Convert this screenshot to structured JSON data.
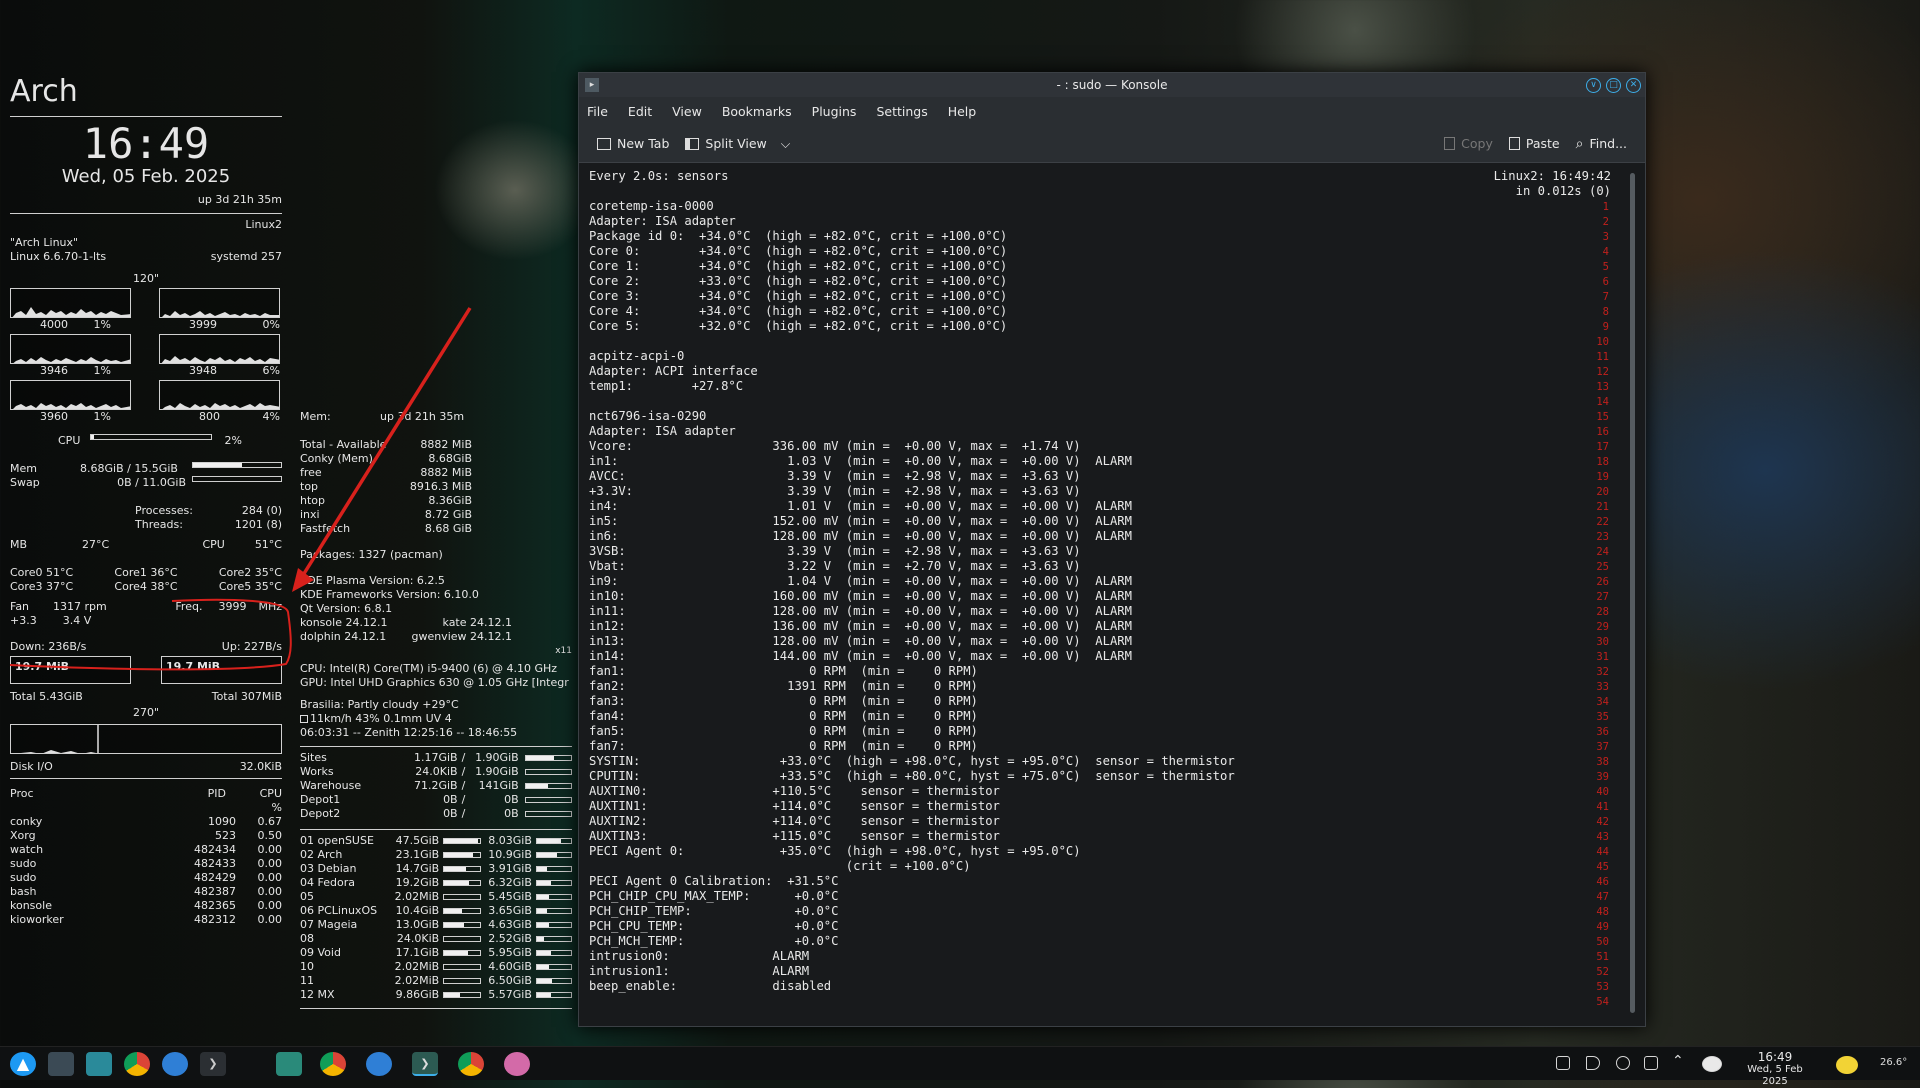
{
  "conky": {
    "distro": "Arch",
    "time": "16:49",
    "date": "Wed, 05 Feb. 2025",
    "uptime": "up 3d 21h 35m",
    "hostname": "Linux2",
    "os": "\"Arch Linux\"",
    "kernel": "Linux 6.6.70-1-lts",
    "init": "systemd 257",
    "interval": "120\"",
    "cpu_cores": [
      {
        "freq": "4000",
        "pct": "1%"
      },
      {
        "freq": "3999",
        "pct": "0%"
      },
      {
        "freq": "3946",
        "pct": "1%"
      },
      {
        "freq": "3948",
        "pct": "6%"
      },
      {
        "freq": "3960",
        "pct": "1%"
      },
      {
        "freq": "800",
        "pct": "4%"
      }
    ],
    "cpu_label": "CPU",
    "cpu_total": "2%",
    "cpu_fill": 0.02,
    "mem_label": "Mem",
    "mem_val": "8.68GiB / 15.5GiB",
    "mem_fill": 0.56,
    "swap_label": "Swap",
    "swap_val": "0B / 11.0GiB",
    "swap_fill": 0.0,
    "proc_label": "Processes:",
    "proc_val": "284 (0)",
    "threads_label": "Threads:",
    "threads_val": "1201 (8)",
    "mb_label": "MB",
    "mb_temp": "27°C",
    "cpu_temp_label": "CPU",
    "cpu_temp": "51°C",
    "cores": [
      "Core0 51°C",
      "Core1 36°C",
      "Core2 35°C",
      "Core3 37°C",
      "Core4 38°C",
      "Core5 35°C"
    ],
    "fan_label": "Fan",
    "fan_val": "1317 rpm",
    "freq_label": "Freq.",
    "freq_val": "3999",
    "freq_unit": "MHz",
    "v33": "+3.3",
    "v34": "3.4 V",
    "down": "Down: 236B/s",
    "up": "Up: 227B/s",
    "down_box": "19.7 MiB",
    "up_box": "19.7 MiB",
    "total_down": "Total 5.43GiB",
    "total_up": "Total 307MiB",
    "interval2": "270\"",
    "diskio_label": "Disk I/O",
    "diskio_val": "32.0KiB",
    "proc_hdr": [
      "Proc",
      "PID",
      "CPU",
      "%"
    ],
    "procs": [
      {
        "n": "conky",
        "p": "1090",
        "c": "0.67"
      },
      {
        "n": "Xorg",
        "p": "523",
        "c": "0.50"
      },
      {
        "n": "watch",
        "p": "482434",
        "c": "0.00"
      },
      {
        "n": "sudo",
        "p": "482433",
        "c": "0.00"
      },
      {
        "n": "sudo",
        "p": "482429",
        "c": "0.00"
      },
      {
        "n": "bash",
        "p": "482387",
        "c": "0.00"
      },
      {
        "n": "konsole",
        "p": "482365",
        "c": "0.00"
      },
      {
        "n": "kioworker",
        "p": "482312",
        "c": "0.00"
      }
    ]
  },
  "conky2": {
    "mem_label": "Mem:",
    "uptime": "up 3d 21h 35m",
    "memrows": [
      {
        "n": "Total - Available",
        "v": "8882 MiB"
      },
      {
        "n": "Conky (Mem)",
        "v": "8.68GiB"
      },
      {
        "n": "free",
        "v": "8882  MiB"
      },
      {
        "n": "top",
        "v": "8916.3  MiB"
      },
      {
        "n": "htop",
        "v": "8.36GiB"
      },
      {
        "n": "inxi",
        "v": "8.72 GiB"
      },
      {
        "n": "Fastfetch",
        "v": "8.68 GiB"
      }
    ],
    "packages": "Packages: 1327 (pacman)",
    "kde": [
      "KDE Plasma Version: 6.2.5",
      "KDE Frameworks Version: 6.10.0",
      "Qt Version: 6.8.1"
    ],
    "konsole": "konsole 24.12.1",
    "kate": "kate 24.12.1",
    "dolphin": "dolphin 24.12.1",
    "gwenview": "gwenview 24.12.1",
    "x11": "x11",
    "cpu": "CPU: Intel(R) Core(TM) i5-9400 (6) @ 4.10 GHz",
    "gpu": "GPU: Intel UHD Graphics 630 @ 1.05 GHz [Integr",
    "weather1": "Brasilia:   Partly cloudy   +29°C",
    "weather2": "11km/h   43%   0.1mm   UV 4",
    "weather3": "06:03:31 -- Zenith 12:25:16 -- 18:46:55",
    "drives": [
      {
        "n": "Sites",
        "u": "1.17GiB",
        "t": "1.90GiB",
        "f": 0.62
      },
      {
        "n": "Works",
        "u": "24.0KiB",
        "t": "1.90GiB",
        "f": 0.0
      },
      {
        "n": "Warehouse",
        "u": "71.2GiB",
        "t": "141GiB",
        "f": 0.5
      },
      {
        "n": "Depot1",
        "u": "0B",
        "t": "0B",
        "f": 0.0
      },
      {
        "n": "Depot2",
        "u": "0B",
        "t": "0B",
        "f": 0.0
      }
    ],
    "parts": [
      {
        "n": "01 openSUSE",
        "a": "47.5GiB",
        "af": 0.95,
        "b": "8.03GiB",
        "bf": 0.7
      },
      {
        "n": "02 Arch",
        "a": "23.1GiB",
        "af": 0.8,
        "b": "10.9GiB",
        "bf": 0.6
      },
      {
        "n": "03 Debian",
        "a": "14.7GiB",
        "af": 0.6,
        "b": "3.91GiB",
        "bf": 0.3
      },
      {
        "n": "04 Fedora",
        "a": "19.2GiB",
        "af": 0.7,
        "b": "6.32GiB",
        "bf": 0.4
      },
      {
        "n": "05",
        "a": "2.02MiB",
        "af": 0.0,
        "b": "5.45GiB",
        "bf": 0.35
      },
      {
        "n": "06 PCLinuxOS",
        "a": "10.4GiB",
        "af": 0.5,
        "b": "3.65GiB",
        "bf": 0.3
      },
      {
        "n": "07 Mageia",
        "a": "13.0GiB",
        "af": 0.55,
        "b": "4.63GiB",
        "bf": 0.35
      },
      {
        "n": "08",
        "a": "24.0KiB",
        "af": 0.0,
        "b": "2.52GiB",
        "bf": 0.2
      },
      {
        "n": "09 Void",
        "a": "17.1GiB",
        "af": 0.65,
        "b": "5.95GiB",
        "bf": 0.4
      },
      {
        "n": "10",
        "a": "2.02MiB",
        "af": 0.0,
        "b": "4.60GiB",
        "bf": 0.35
      },
      {
        "n": "11",
        "a": "2.02MiB",
        "af": 0.0,
        "b": "6.50GiB",
        "bf": 0.45
      },
      {
        "n": "12 MX",
        "a": "9.86GiB",
        "af": 0.45,
        "b": "5.57GiB",
        "bf": 0.4
      }
    ]
  },
  "konsole": {
    "title": "- : sudo — Konsole",
    "menu": [
      "File",
      "Edit",
      "View",
      "Bookmarks",
      "Plugins",
      "Settings",
      "Help"
    ],
    "new_tab": "New Tab",
    "split_view": "Split View",
    "copy": "Copy",
    "paste": "Paste",
    "find": "Find...",
    "term_right1": "Linux2: 16:49:42",
    "term_right2": "in 0.012s (0)",
    "output": "Every 2.0s: sensors\n\ncoretemp-isa-0000\nAdapter: ISA adapter\nPackage id 0:  +34.0°C  (high = +82.0°C, crit = +100.0°C)\nCore 0:        +34.0°C  (high = +82.0°C, crit = +100.0°C)\nCore 1:        +34.0°C  (high = +82.0°C, crit = +100.0°C)\nCore 2:        +33.0°C  (high = +82.0°C, crit = +100.0°C)\nCore 3:        +34.0°C  (high = +82.0°C, crit = +100.0°C)\nCore 4:        +34.0°C  (high = +82.0°C, crit = +100.0°C)\nCore 5:        +32.0°C  (high = +82.0°C, crit = +100.0°C)\n\nacpitz-acpi-0\nAdapter: ACPI interface\ntemp1:        +27.8°C\n\nnct6796-isa-0290\nAdapter: ISA adapter\nVcore:                   336.00 mV (min =  +0.00 V, max =  +1.74 V)\nin1:                       1.03 V  (min =  +0.00 V, max =  +0.00 V)  ALARM\nAVCC:                      3.39 V  (min =  +2.98 V, max =  +3.63 V)\n+3.3V:                     3.39 V  (min =  +2.98 V, max =  +3.63 V)\nin4:                       1.01 V  (min =  +0.00 V, max =  +0.00 V)  ALARM\nin5:                     152.00 mV (min =  +0.00 V, max =  +0.00 V)  ALARM\nin6:                     128.00 mV (min =  +0.00 V, max =  +0.00 V)  ALARM\n3VSB:                      3.39 V  (min =  +2.98 V, max =  +3.63 V)\nVbat:                      3.22 V  (min =  +2.70 V, max =  +3.63 V)\nin9:                       1.04 V  (min =  +0.00 V, max =  +0.00 V)  ALARM\nin10:                    160.00 mV (min =  +0.00 V, max =  +0.00 V)  ALARM\nin11:                    128.00 mV (min =  +0.00 V, max =  +0.00 V)  ALARM\nin12:                    136.00 mV (min =  +0.00 V, max =  +0.00 V)  ALARM\nin13:                    128.00 mV (min =  +0.00 V, max =  +0.00 V)  ALARM\nin14:                    144.00 mV (min =  +0.00 V, max =  +0.00 V)  ALARM\nfan1:                         0 RPM  (min =    0 RPM)\nfan2:                      1391 RPM  (min =    0 RPM)\nfan3:                         0 RPM  (min =    0 RPM)\nfan4:                         0 RPM  (min =    0 RPM)\nfan5:                         0 RPM  (min =    0 RPM)\nfan7:                         0 RPM  (min =    0 RPM)\nSYSTIN:                   +33.0°C  (high = +98.0°C, hyst = +95.0°C)  sensor = thermistor\nCPUTIN:                   +33.5°C  (high = +80.0°C, hyst = +75.0°C)  sensor = thermistor\nAUXTIN0:                 +110.5°C    sensor = thermistor\nAUXTIN1:                 +114.0°C    sensor = thermistor\nAUXTIN2:                 +114.0°C    sensor = thermistor\nAUXTIN3:                 +115.0°C    sensor = thermistor\nPECI Agent 0:             +35.0°C  (high = +98.0°C, hyst = +95.0°C)\n                                   (crit = +100.0°C)\nPECI Agent 0 Calibration:  +31.5°C\nPCH_CHIP_CPU_MAX_TEMP:      +0.0°C\nPCH_CHIP_TEMP:              +0.0°C\nPCH_CPU_TEMP:               +0.0°C\nPCH_MCH_TEMP:               +0.0°C\nintrusion0:              ALARM\nintrusion1:              ALARM\nbeep_enable:             disabled",
    "line_numbers": "1\n2\n3\n4\n5\n6\n7\n8\n9\n10\n11\n12\n13\n14\n15\n16\n17\n18\n19\n20\n21\n22\n23\n24\n25\n26\n27\n28\n29\n30\n31\n32\n33\n34\n35\n36\n37\n38\n39\n40\n41\n42\n43\n44\n45\n46\n47\n48\n49\n50\n51\n52\n53\n54"
  },
  "taskbar": {
    "clock_time": "16:49",
    "clock_date": "Wed, 5 Feb 2025",
    "temp": "26.6°"
  },
  "colors": {
    "annotation": "#d8211c",
    "accent": "#1d99f3"
  }
}
